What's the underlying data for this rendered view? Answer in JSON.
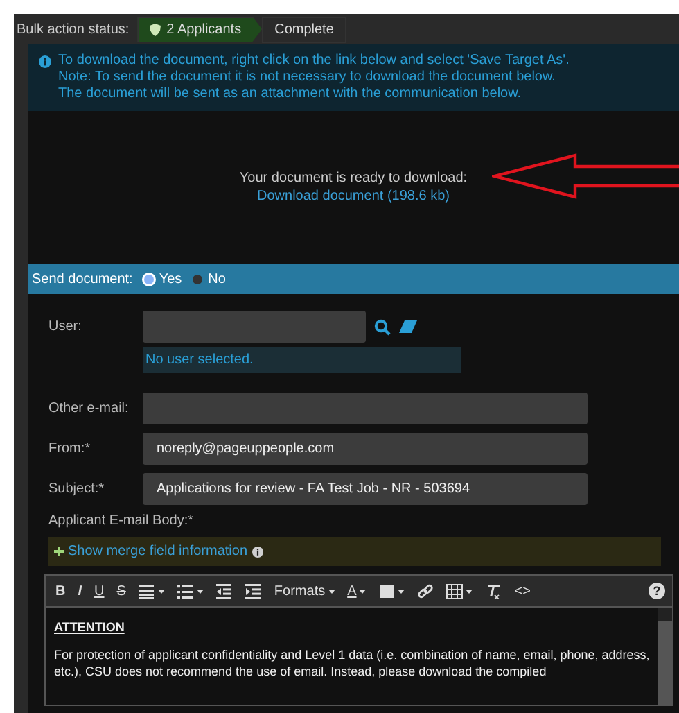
{
  "status_bar": {
    "label": "Bulk action status:",
    "steps": [
      {
        "label": "2 Applicants",
        "selected": true
      },
      {
        "label": "Complete",
        "selected": false
      }
    ]
  },
  "info": {
    "lines": [
      "To download the document, right click on the link below and select 'Save Target As'.",
      "Note: To send the document it is not necessary to download the document below.",
      "The document will be sent as an attachment with the communication below."
    ]
  },
  "download": {
    "message": "Your document is ready to download:",
    "link": "Download document (198.6 kb)"
  },
  "send_document": {
    "label": "Send document:",
    "options": [
      {
        "label": "Yes",
        "selected": true
      },
      {
        "label": "No",
        "selected": false
      }
    ]
  },
  "form": {
    "user": {
      "label": "User:",
      "status": "No user selected."
    },
    "fields": [
      {
        "label": "Other e-mail:"
      },
      {
        "label": "From:*",
        "value": "noreply@pageuppeople.com"
      },
      {
        "label": "Subject:*",
        "value": "Applications for review - FA Test Job - NR - 503694"
      }
    ],
    "body_label": "Applicant E-mail Body:*",
    "merge_link": "Show merge field information"
  },
  "editor": {
    "toolbar": [
      {
        "kind": "text",
        "label": "B"
      },
      {
        "kind": "text",
        "label": "I"
      },
      {
        "kind": "text",
        "label": "U"
      },
      {
        "kind": "text",
        "label": "S"
      },
      {
        "kind": "icon",
        "dropdown": true
      },
      {
        "kind": "icon",
        "dropdown": true
      },
      {
        "kind": "icon"
      },
      {
        "kind": "icon"
      },
      {
        "kind": "text",
        "label": "Formats",
        "dropdown": true
      },
      {
        "kind": "text",
        "label": "A",
        "dropdown": true
      },
      {
        "kind": "icon",
        "dropdown": true
      },
      {
        "kind": "icon"
      },
      {
        "kind": "icon",
        "dropdown": true
      },
      {
        "kind": "icon"
      },
      {
        "kind": "text",
        "label": "<>"
      },
      {
        "kind": "help",
        "label": "?"
      }
    ],
    "heading": "ATTENTION",
    "paragraph": "For protection of applicant confidentiality and Level 1 data (i.e. combination of name, email, phone, address, etc.), CSU does not recommend the use of email. Instead, please download the compiled"
  }
}
